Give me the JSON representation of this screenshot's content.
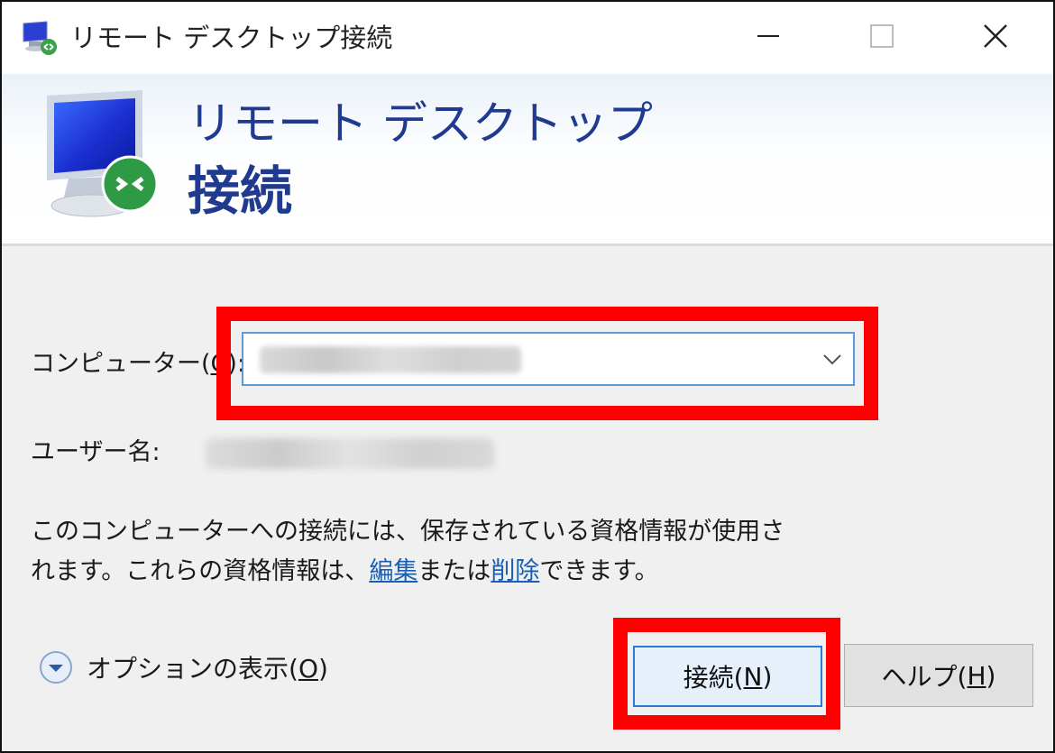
{
  "window": {
    "title": "リモート デスクトップ接続",
    "minimize_icon": "minimize-icon",
    "maximize_icon": "maximize-icon",
    "close_icon": "close-icon"
  },
  "banner": {
    "icon": "remote-desktop-monitor-icon",
    "line1": "リモート デスクトップ",
    "line2": "接続"
  },
  "form": {
    "computer_label_pre": "コンピューター(",
    "computer_label_key": "C",
    "computer_label_post": "):",
    "computer_value": "",
    "username_label": "ユーザー名:",
    "username_value": ""
  },
  "info": {
    "text_before": "このコンピューターへの接続には、保存されている資格情報が使用さ",
    "text_line2_before": "れます。これらの資格情報は、",
    "edit_link": "編集",
    "text_middle": "または",
    "delete_link": "削除",
    "text_after": "できます。"
  },
  "options": {
    "label_pre": "オプションの表示(",
    "label_key": "O",
    "label_post": ")"
  },
  "buttons": {
    "connect_pre": "接続(",
    "connect_key": "N",
    "connect_post": ")",
    "help_pre": "ヘルプ(",
    "help_key": "H",
    "help_post": ")"
  },
  "colors": {
    "highlight": "#ff0000",
    "banner_text": "#1f3a8f",
    "link": "#1a5fb4",
    "focus_border": "#2a7bd4"
  }
}
